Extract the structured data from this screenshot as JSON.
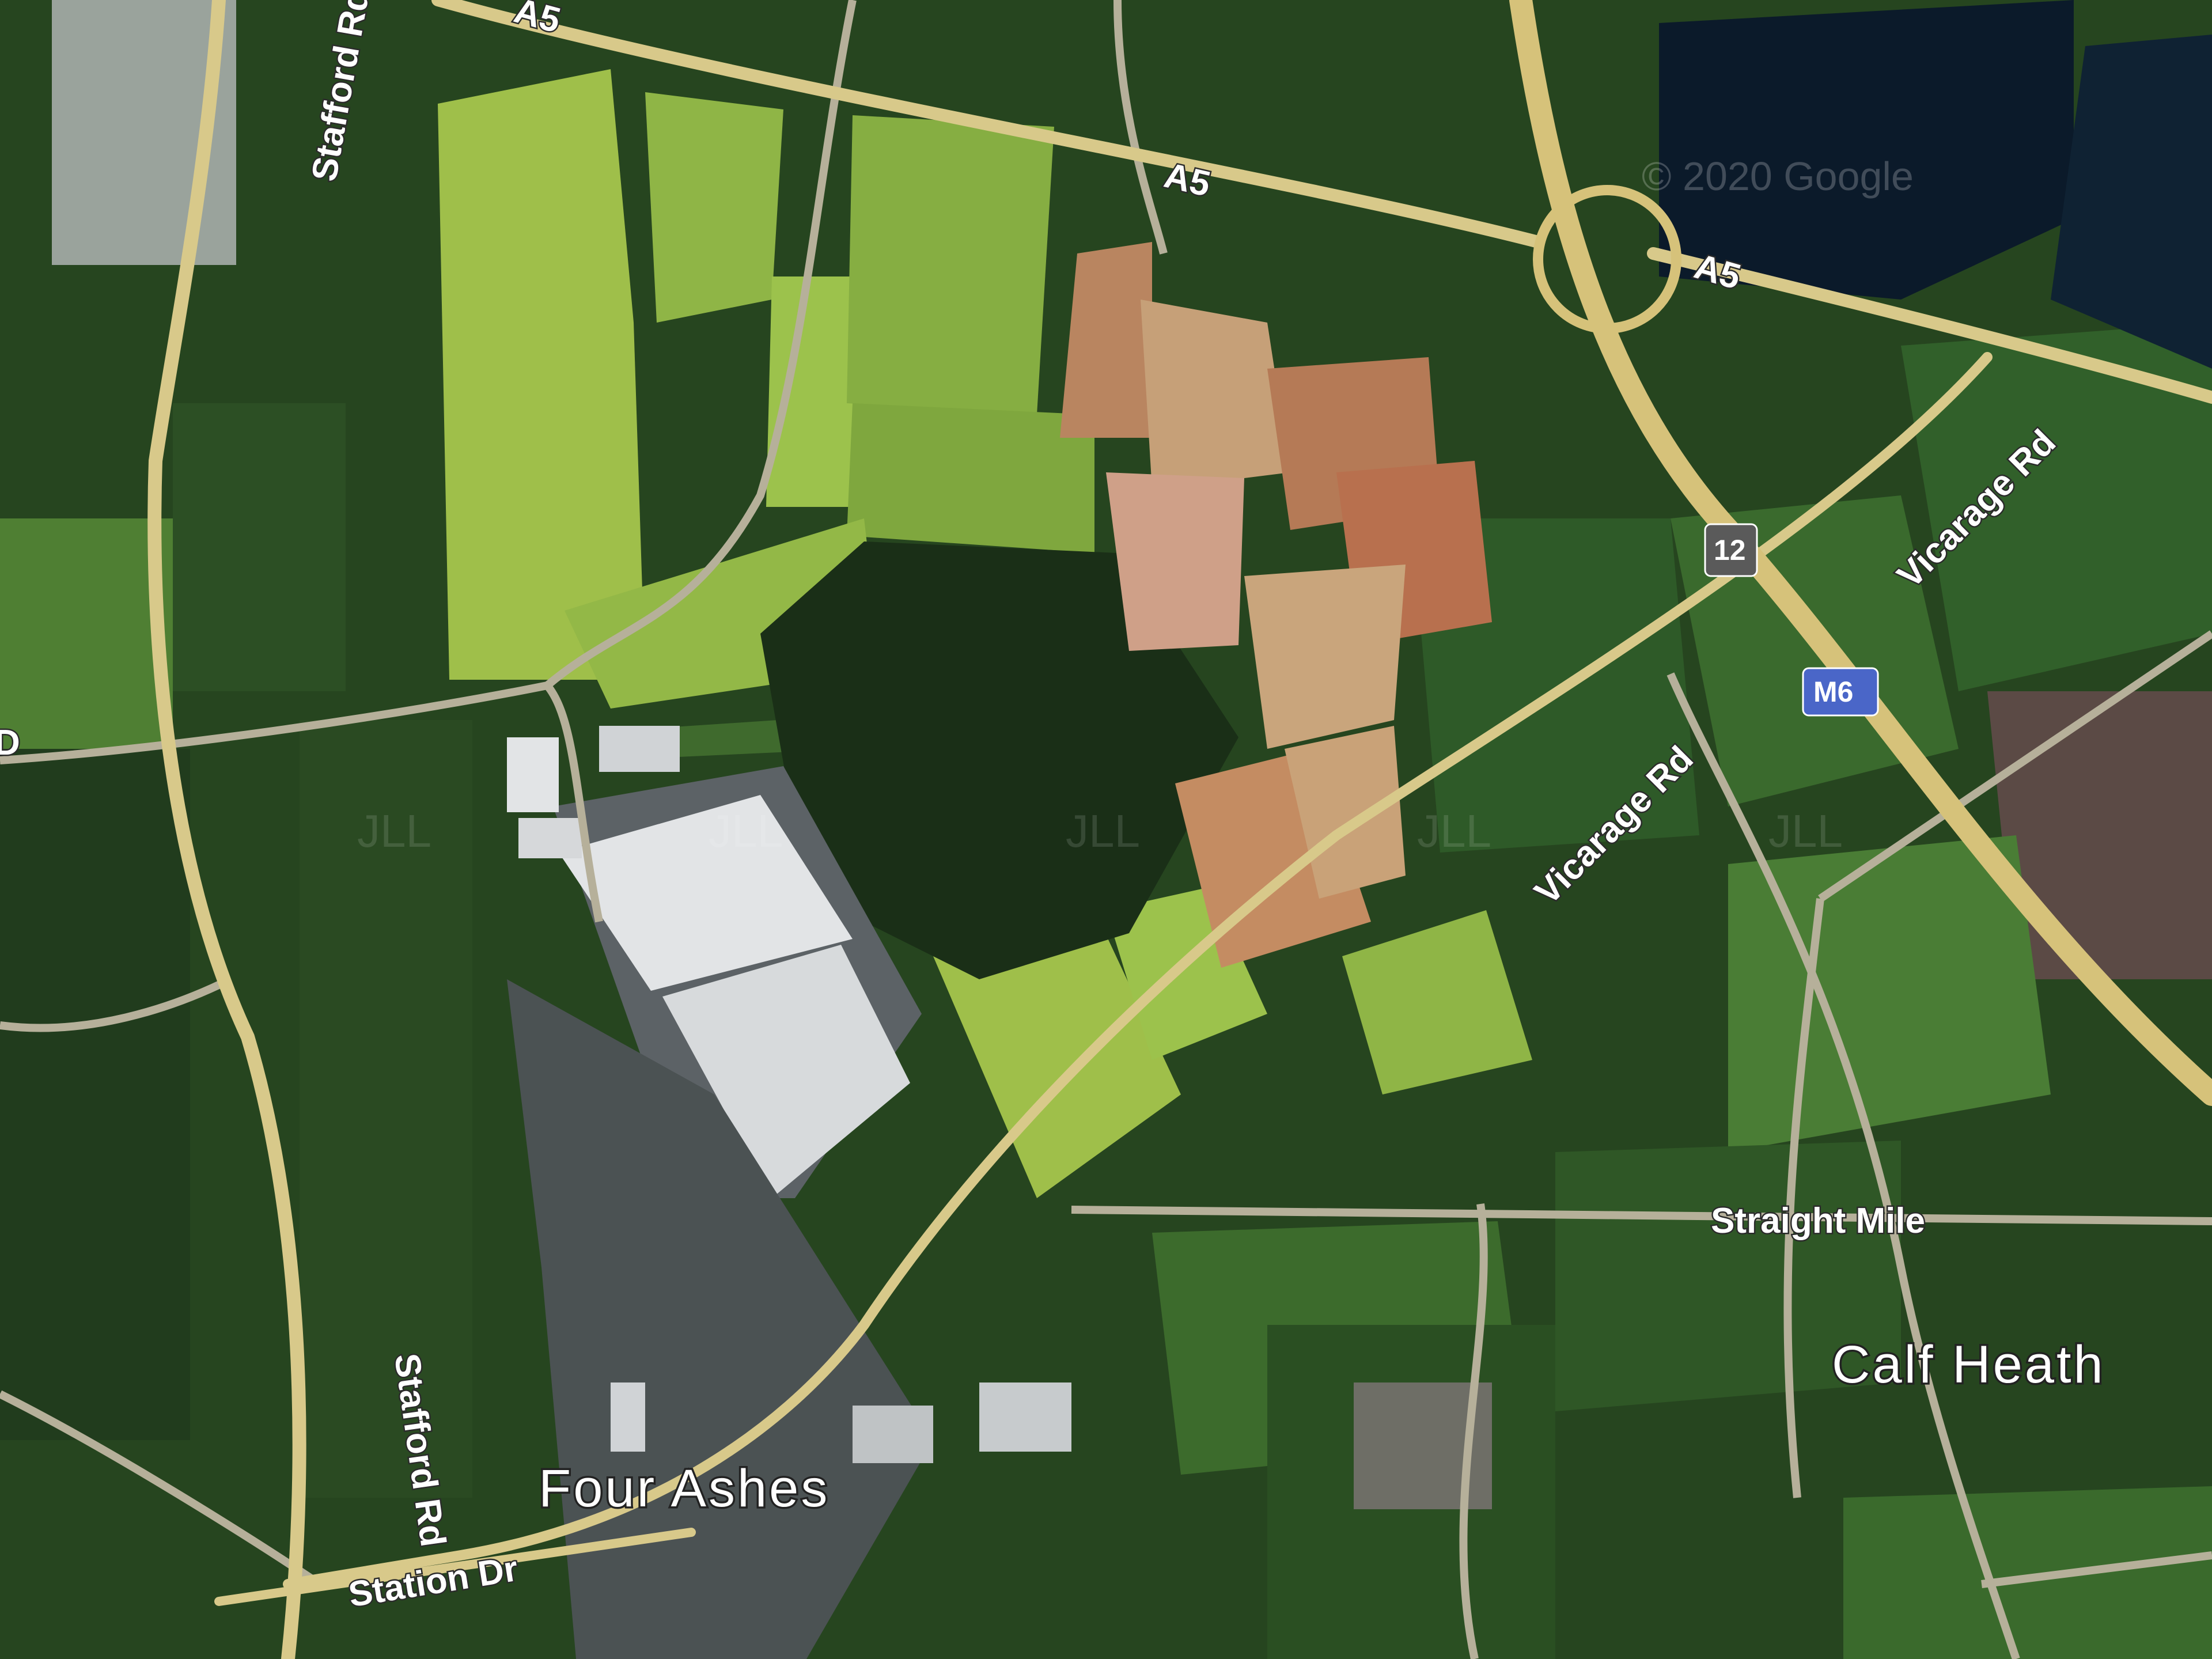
{
  "map": {
    "attribution": "© 2020 Google",
    "watermark": "JLL",
    "colors": {
      "forest": "#1f3a1c",
      "field_light": "#9fbf4a",
      "field_mid": "#6f9a3a",
      "field_dark": "#2f5426",
      "quarry": "#b9805a",
      "warehouse": "#e2e4e6",
      "water": "#0b1a2a",
      "road": "#d8c98a",
      "motorway": "#d6c27a",
      "motorway_shield": "#4a66c8",
      "junction_shield": "#5a5a5a"
    },
    "roads": {
      "a5_top": "A5",
      "a5_mid": "A5",
      "a5_right": "A5",
      "stafford_top": "Stafford Rd",
      "stafford_bottom": "Stafford Rd",
      "vicarage_upper": "Vicarage Rd",
      "vicarage_lower": "Vicarage Rd",
      "straight_mile": "Straight Mile",
      "station_dr": "Station Dr",
      "left_edge_fragment": "D"
    },
    "shields": {
      "motorway": "M6",
      "junction": "12"
    },
    "places": {
      "four_ashes": "Four Ashes",
      "calf_heath": "Calf Heath"
    }
  }
}
